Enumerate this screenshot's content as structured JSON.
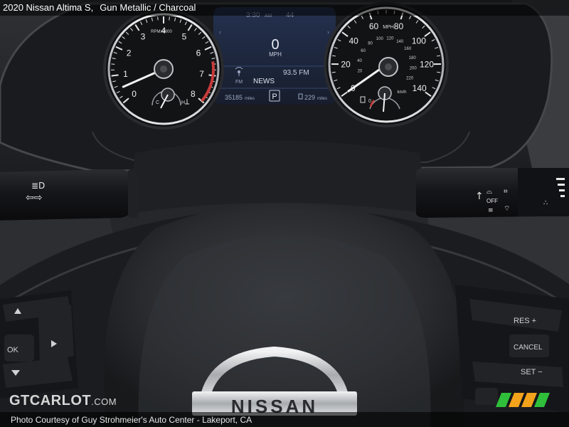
{
  "caption": {
    "title": "2020 Nissan Altima S,",
    "exterior": "Gun Metallic",
    "divider": "/",
    "interior": "Charcoal"
  },
  "cluster": {
    "clock": "3:30",
    "clock_suffix": "AM",
    "outside_temp": "44",
    "speed_value": "0",
    "speed_unit": "MPH",
    "radio_band": "FM",
    "radio_station": "NEWS",
    "radio_frequency": "93.5 FM",
    "odometer": "35185",
    "odometer_unit": "miles",
    "gear": "P",
    "range": "229",
    "range_unit": "miles"
  },
  "tachometer": {
    "unit_label": "RPMx1000",
    "ticks": [
      "0",
      "1",
      "2",
      "3",
      "4",
      "5",
      "6",
      "7",
      "8"
    ],
    "temp_low": "C",
    "temp_high": "H",
    "needle_value": 0.5
  },
  "speedometer": {
    "unit_label": "MPH",
    "ticks": [
      "0",
      "20",
      "40",
      "60",
      "80",
      "100",
      "120",
      "140"
    ],
    "inner_unit_label": "km/h",
    "inner_ticks": [
      "20",
      "40",
      "60",
      "80",
      "100",
      "120",
      "140",
      "160",
      "180",
      "200",
      "220"
    ],
    "fuel_empty": "0",
    "needle_value": 0
  },
  "stalks": {
    "wiper_off": "OFF"
  },
  "steering_wheel": {
    "brand": "NISSAN",
    "right_buttons": [
      "RES +",
      "CANCEL",
      "SET −"
    ],
    "left_buttons": [
      "OK"
    ]
  },
  "watermark": {
    "brand": "GTCARLOT",
    "suffix": ".COM"
  },
  "credit": "Photo Courtesy of Guy Strohmeier's Auto Center - Lakeport, CA",
  "colors": {
    "dash_dark": "#1c1d20",
    "dial_face": "#121315",
    "chrome": "#d6d8da",
    "screen_blue": "#1f2b44",
    "redline": "#c73b3b",
    "logo_green": "#2fbf3a",
    "logo_orange": "#f2a21b"
  }
}
